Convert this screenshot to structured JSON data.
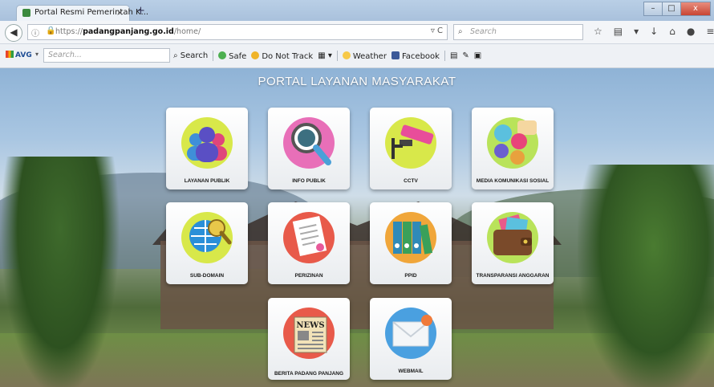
{
  "browser": {
    "tab_title": "Portal Resmi Pemerintah K...",
    "tab_close": "×",
    "new_tab": "+",
    "window_buttons": {
      "minimize": "–",
      "maximize": "□",
      "close": "x"
    },
    "url_prefix": "https://",
    "url_domain": "padangpanjang.go.id",
    "url_path": "/home/",
    "search_placeholder": "Search"
  },
  "avg_toolbar": {
    "logo": "AVG",
    "search_placeholder": "Search...",
    "search_label": "Search",
    "safe_label": "Safe",
    "donottrack_label": "Do Not Track",
    "weather_label": "Weather",
    "facebook_label": "Facebook"
  },
  "page": {
    "title": "PORTAL LAYANAN MASYARAKAT",
    "tiles": [
      {
        "label": "LAYANAN PUBLIK",
        "icon": "people-icon"
      },
      {
        "label": "INFO PUBLIK",
        "icon": "magnifier-icon"
      },
      {
        "label": "CCTV",
        "icon": "cctv-camera-icon"
      },
      {
        "label": "MEDIA KOMUNIKASI SOSIAL",
        "icon": "chat-bubbles-icon"
      },
      {
        "label": "SUB-DOMAIN",
        "icon": "globe-www-icon"
      },
      {
        "label": "PERIZINAN",
        "icon": "document-icon"
      },
      {
        "label": "PPID",
        "icon": "binders-icon"
      },
      {
        "label": "TRANSPARANSI ANGGARAN",
        "icon": "wallet-icon"
      },
      {
        "label": "BERITA PADANG PANJANG",
        "icon": "newspaper-icon",
        "icon_text": "NEWS"
      },
      {
        "label": "WEBMAIL",
        "icon": "envelope-icon"
      }
    ]
  },
  "colors": {
    "tile_bg": "#ffffff",
    "title_text": "#ffffff"
  }
}
